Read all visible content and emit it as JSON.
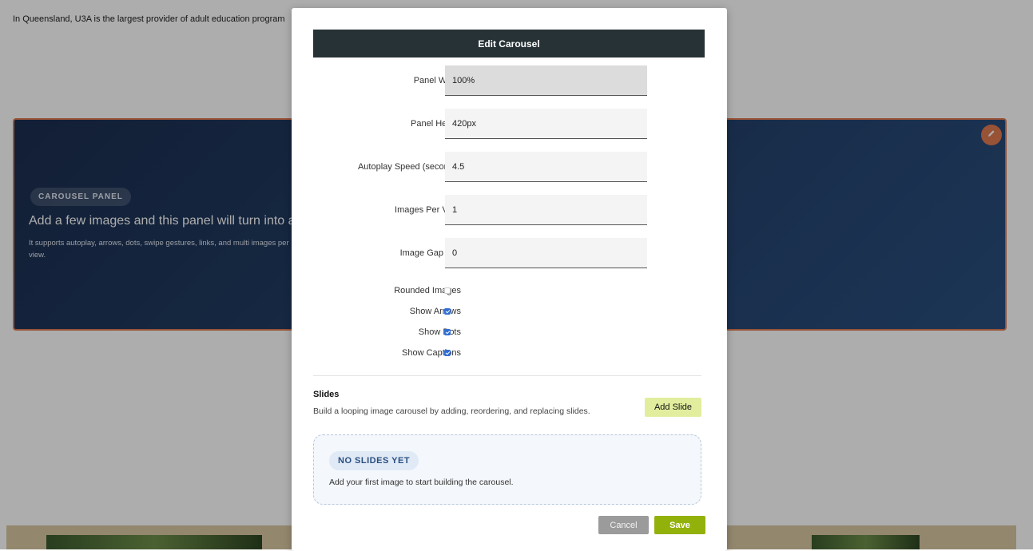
{
  "background": {
    "intro_text": "In Queensland, U3A is the largest provider of adult education program",
    "panel": {
      "badge": "CAROUSEL PANEL",
      "heading": "Add a few images and this panel will turn into a",
      "description": "It supports autoplay, arrows, dots, swipe gestures, links, and multi images per view.",
      "edit_icon": "pencil-icon"
    }
  },
  "modal": {
    "title": "Edit Carousel",
    "fields": [
      {
        "label": "Panel Width",
        "value": "100%"
      },
      {
        "label": "Panel Height",
        "value": "420px"
      },
      {
        "label": "Autoplay Speed (seconds)",
        "value": "4.5"
      },
      {
        "label": "Images Per View",
        "value": "1"
      },
      {
        "label": "Image Gap (px)",
        "value": "0"
      }
    ],
    "checkboxes": [
      {
        "label": "Rounded Images",
        "checked": false
      },
      {
        "label": "Show Arrows",
        "checked": true
      },
      {
        "label": "Show Dots",
        "checked": true
      },
      {
        "label": "Show Captions",
        "checked": true
      }
    ],
    "slides": {
      "title": "Slides",
      "description": "Build a looping image carousel by adding, reordering, and replacing slides.",
      "add_button": "Add Slide",
      "empty_badge": "NO SLIDES YET",
      "empty_text": "Add your first image to start building the carousel."
    },
    "cancel_button": "Cancel",
    "save_button": "Save"
  },
  "colors": {
    "modal_header": "#263236",
    "save": "#93b10b",
    "add_slide": "#e2ee9e",
    "panel_border": "#e07a50",
    "checkbox_checked": "#2f6fd6"
  }
}
